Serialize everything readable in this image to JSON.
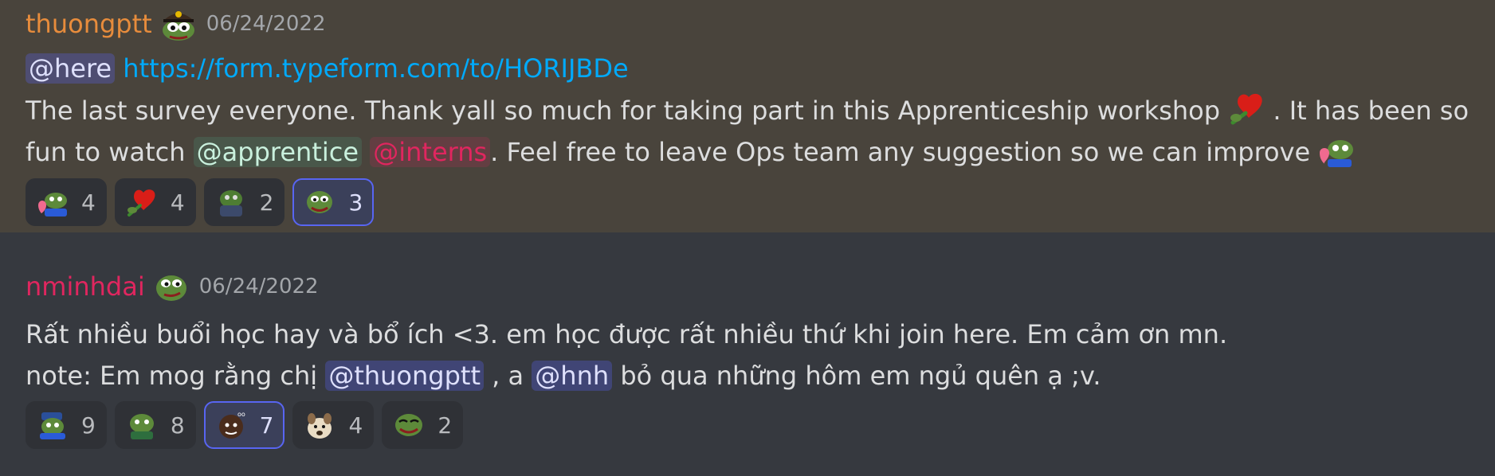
{
  "messages": [
    {
      "username": "thuongptt",
      "timestamp": "06/24/2022",
      "line1": {
        "mention": "@here",
        "link": "https://form.typeform.com/to/HORIJBDe"
      },
      "line2": {
        "text_before": "The last survey everyone. Thank yall so much for taking part in this Apprenticeship workshop",
        "text_after": ". It has been so"
      },
      "line3": {
        "text_before": "fun to watch",
        "mention_apprentice": "@apprentice",
        "mention_interns": "@interns",
        "text_after": ". Feel free to leave Ops team any suggestion so we can improve"
      },
      "reactions": [
        {
          "emoji": "pepe-hug-icon",
          "count": "4"
        },
        {
          "emoji": "pepe-heart-rose-icon",
          "count": "4"
        },
        {
          "emoji": "pepe-blanket-icon",
          "count": "2"
        },
        {
          "emoji": "pepe-happy-icon",
          "count": "3",
          "active": true
        }
      ]
    },
    {
      "username": "nminhdai",
      "timestamp": "06/24/2022",
      "line1": {
        "text": "Rất nhiều buổi học hay và bổ ích <3. em học được rất nhiều thứ khi join here. Em cảm ơn mn."
      },
      "line2": {
        "text_before": "note: Em mog rằng chị",
        "mention_thuong": "@thuongptt",
        "text_mid": ", a",
        "mention_hnh": "@hnh",
        "text_after": "bỏ qua những hôm em ngủ quên ạ ;v."
      },
      "reactions": [
        {
          "emoji": "pepe-salute-icon",
          "count": "9"
        },
        {
          "emoji": "pepe-thinking-icon",
          "count": "8"
        },
        {
          "emoji": "meme-face-icon",
          "count": "7",
          "active": true
        },
        {
          "emoji": "dog-cheems-icon",
          "count": "4"
        },
        {
          "emoji": "pepe-smile-icon",
          "count": "2"
        }
      ]
    }
  ],
  "colors": {
    "username_1": "#e78c3c",
    "username_2": "#e0265f",
    "link": "#00aafc",
    "active_border": "#5865f2"
  }
}
